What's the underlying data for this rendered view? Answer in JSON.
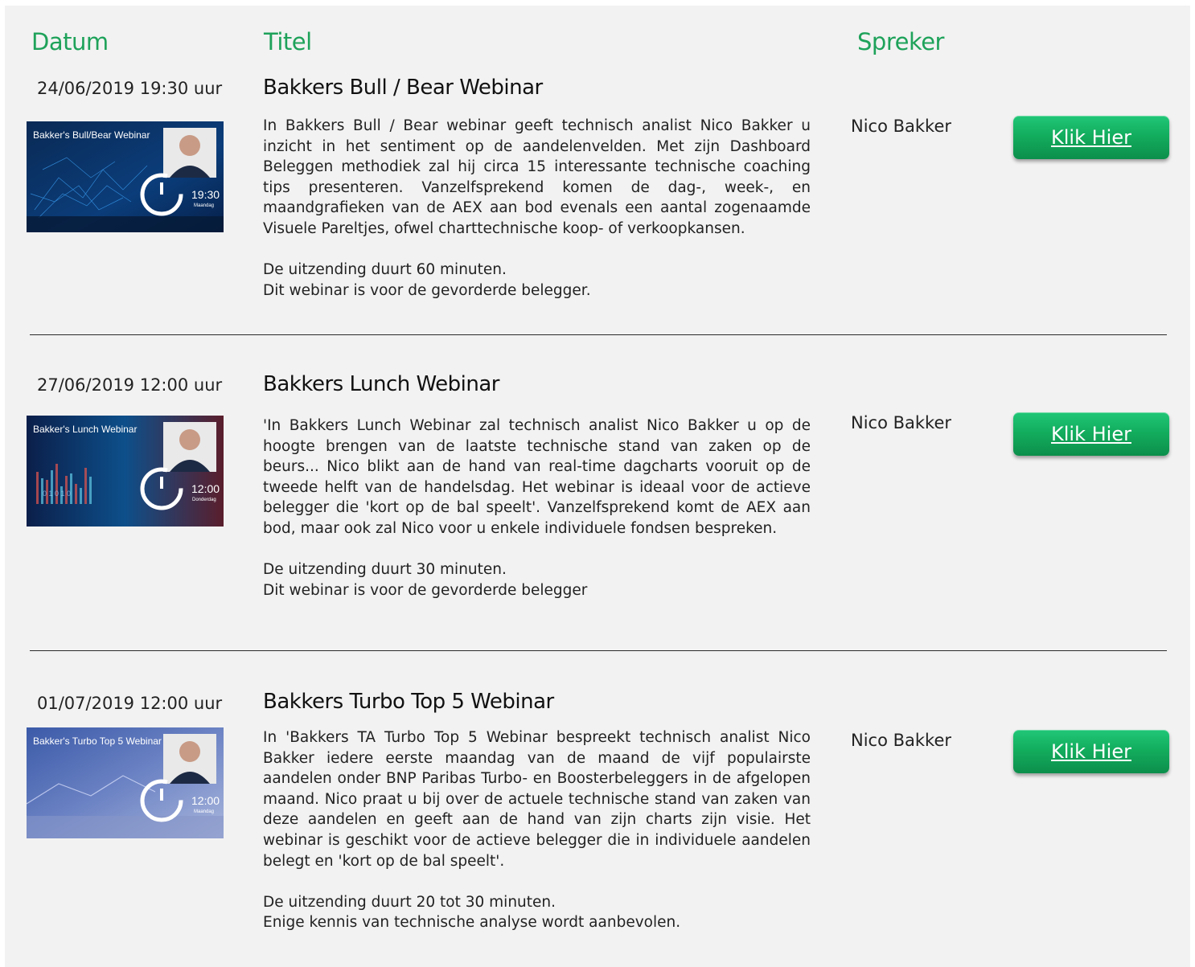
{
  "headers": {
    "date": "Datum",
    "title": "Titel",
    "speaker": "Spreker"
  },
  "webinars": [
    {
      "date": "24/06/2019 19:30 uur",
      "title": "Bakkers Bull / Bear Webinar",
      "description": "In Bakkers Bull / Bear webinar geeft technisch analist Nico Bakker u inzicht in het sentiment op de aandelenvelden. Met zijn Dashboard Beleggen methodiek zal hij circa 15 interessante technische coaching tips presenteren. Vanzelfsprekend komen de dag-, week-, en maandgrafieken van de AEX aan bod evenals een aantal zogenaamde Visuele Pareltjes, ofwel charttechnische koop- of verkoopkansen.",
      "duration": "De uitzending duurt 60 minuten.",
      "audience": "Dit webinar is voor de gevorderde belegger.",
      "speaker": "Nico Bakker",
      "button": "Klik Hier",
      "thumb": {
        "caption": "Bakker's Bull/Bear Webinar",
        "time": "19:30",
        "day": "Maandag"
      }
    },
    {
      "date": "27/06/2019 12:00 uur",
      "title": "Bakkers Lunch Webinar",
      "description": "'In Bakkers Lunch Webinar zal technisch analist Nico Bakker u op de hoogte brengen van de laatste technische stand van zaken op de beurs... Nico blikt aan de hand van real-time dagcharts vooruit op de tweede helft van de handelsdag. Het webinar is ideaal voor de actieve belegger die 'kort op de bal speelt'. Vanzelfsprekend komt de AEX aan bod, maar ook zal Nico voor u enkele individuele fondsen bespreken.",
      "duration": "De uitzending duurt 30 minuten.",
      "audience": "Dit webinar is voor de gevorderde belegger",
      "speaker": "Nico Bakker",
      "button": "Klik Hier",
      "thumb": {
        "caption": "Bakker's Lunch Webinar",
        "time": "12:00",
        "day": "Donderdag"
      }
    },
    {
      "date": "01/07/2019 12:00 uur",
      "title": "Bakkers Turbo Top 5 Webinar",
      "description": "In 'Bakkers TA Turbo Top 5 Webinar bespreekt technisch analist Nico Bakker iedere eerste maandag van de maand de vijf populairste aandelen onder BNP Paribas Turbo- en Boosterbeleggers in de afgelopen maand. Nico praat u bij over de actuele technische stand van zaken van deze aandelen en geeft aan de hand van zijn charts zijn visie. Het webinar is geschikt voor de actieve belegger die in individuele aandelen belegt en 'kort op de bal speelt'.",
      "duration": "De uitzending duurt 20 tot 30 minuten.",
      "audience": "Enige kennis van technische analyse wordt aanbevolen.",
      "speaker": "Nico Bakker",
      "button": "Klik Hier",
      "thumb": {
        "caption": "Bakker's Turbo Top 5 Webinar",
        "time": "12:00",
        "day": "Maandag"
      }
    }
  ],
  "colors": {
    "header": "#1ea25a",
    "button": "#13ad5e",
    "panel": "#f2f2f2"
  },
  "icons": {
    "thumbnail_overlay": "clock-refresh-icon"
  }
}
